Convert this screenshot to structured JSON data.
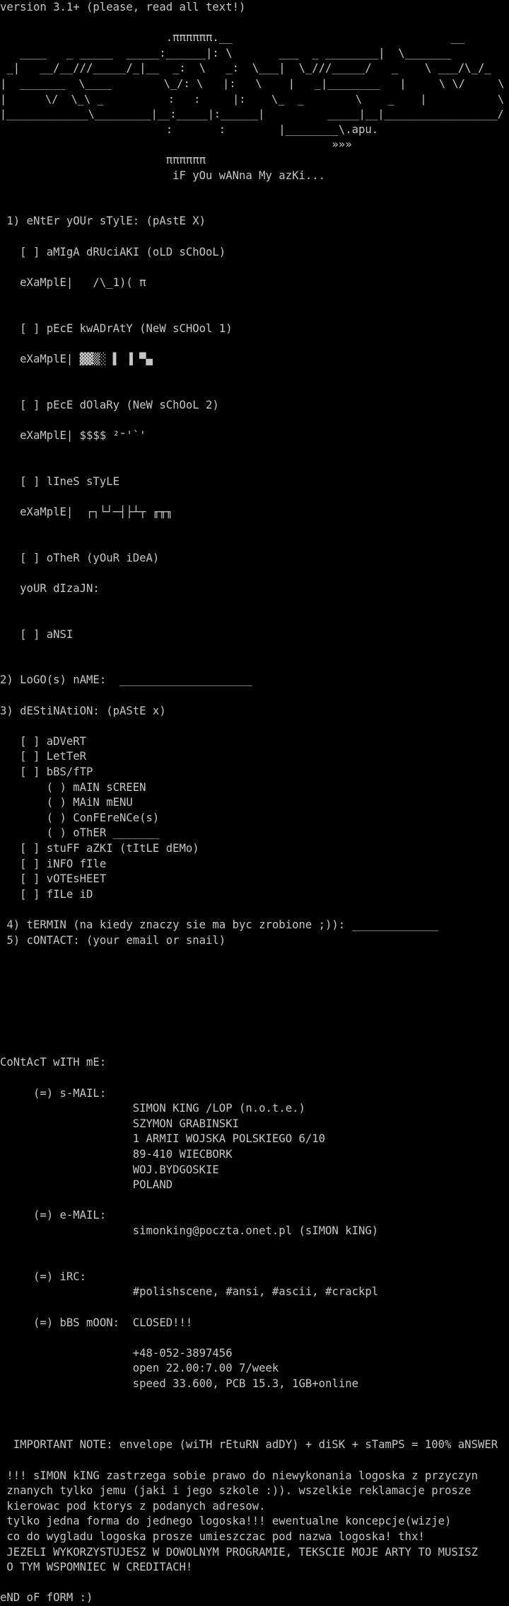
{
  "colors": {
    "background": "#000000",
    "text": "#c6c6c6"
  },
  "lines": [
    "version 3.1+ (please, read all text!)",
    "",
    "                         .ππππππ.__                                 __",
    "   ____   _ _____  _____:______|: \\       ___  _ ________|  \\_______",
    " _|   __/__///_____/_|__  _:  \\   _:  \\___|  \\_///_____/   _    \\ ___/\\_/_",
    "|  _______  \\____        \\_/: \\   |:   \\    |   _|________   |     \\ \\/     \\",
    "|      \\/  \\_\\ _          :   :     |:    \\_  _        \\    _    |           \\",
    "|_____________\\_________|__:_____|:______|          _____|__|__________________/",
    "                         :       :        |________\\.apu.",
    "                                                  »»»",
    "                         ππππππ",
    "                          iF yOu wANna My azKi...",
    "",
    "",
    " 1) eNtEr yOUr sTylE: (pAstE X)",
    "",
    "   [ ] aMIgA dRUciAKI (oLD sChOoL)",
    "",
    "   eXaMplE|   /\\_1)( π",
    "",
    "",
    "   [ ] pEcE kwADrAtY (NeW sCHOol 1)",
    "",
    "   eXaMplE| ▓▓▒░ ▌ ▐ ▀▄",
    "",
    "",
    "   [ ] pEcE dOlaRy (NeW sChOoL 2)",
    "",
    "   eXaMplE| $$$$ ²⁼'`'",
    "",
    "",
    "   [ ] lIneS sTyLE",
    "",
    "   eXaMplE|  ┌┐└┘─┤├┴┬ ╓╥╖",
    "",
    "",
    "   [ ] oTheR (yOuR iDeA)",
    "",
    "   yoUR dIzaJN:",
    "",
    "",
    "   [ ] aNSI",
    "",
    "",
    "2) LoGO(s) nAME:  ____________________",
    "",
    "3) dEStiNAtiON: (pAStE x)",
    "",
    "   [ ] aDVeRT",
    "   [ ] LetTeR",
    "   [ ] bBS/fTP",
    "       ( ) mAIN sCREEN",
    "       ( ) MAiN mENU",
    "       ( ) ConFEreNCe(s)",
    "       ( ) oThER _______",
    "   [ ] stuFF aZKI (tItLE dEMo)",
    "   [ ] iNFO fIle",
    "   [ ] vOTEsHEET",
    "   [ ] fILe iD",
    "",
    " 4) tERMIN (na kiedy znaczy sie ma byc zrobione ;)): _____________",
    " 5) cONTACT: (your email or snail)",
    "",
    "",
    "",
    "",
    "",
    "",
    "",
    "CoNtAcT wITH mE:",
    "",
    "     (=) s-MAIL:",
    "                    SIMON KING /LOP (n.o.t.e.)",
    "                    SZYMON GRABINSKI",
    "                    1 ARMII WOJSKA POLSKIEGO 6/10",
    "                    89-410 WIECBORK",
    "                    WOJ.BYDGOSKIE",
    "                    POLAND",
    "",
    "     (=) e-MAIL:",
    "                    simonking@poczta.onet.pl (sIMON kING)",
    "",
    "",
    "     (=) iRC:",
    "                    #polishscene, #ansi, #ascii, #crackpl",
    "",
    "     (=) bBS mOON:  CLOSED!!!",
    "",
    "                    +48-052-3897456",
    "                    open 22.00:7.00 7/week",
    "                    speed 33.600, PCB 15.3, 1GB+online",
    "",
    "",
    "",
    "  IMPORTANT NOTE: envelope (wiTH rEtuRN adDY) + diSK + sTamPS = 100% aNSWER",
    "",
    " !!! sIMON kING zastrzega sobie prawo do niewykonania logoska z przyczyn",
    " znanych tylko jemu (jaki i jego szkole :)). wszelkie reklamacje prosze",
    " kierowac pod ktorys z podanych adresow.",
    " tylko jedna forma do jednego logoska!!! ewentualne koncepcje(wizje)",
    " co do wygladu logoska prosze umieszczac pod nazwa logoska! thx!",
    " JEZELI WYKORZYSTUJESZ W DOWOLNYM PROGRAMIE, TEKSCIE MOJE ARTY TO MUSISZ",
    " O TYM WSPOMNIEC W CREDITACH!",
    "",
    "eND oF fORM :)"
  ]
}
